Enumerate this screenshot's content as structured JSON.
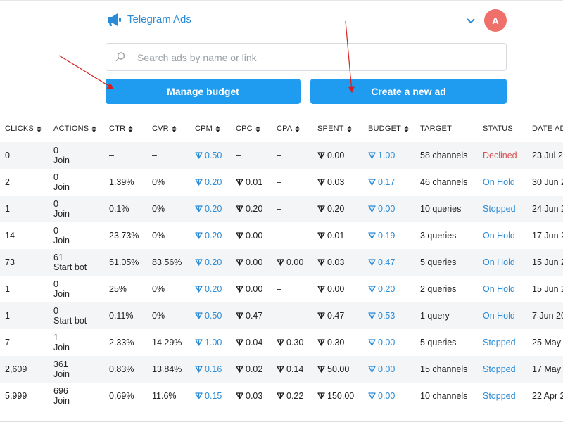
{
  "header": {
    "title": "Telegram Ads",
    "avatar_text": "A"
  },
  "search": {
    "placeholder": "Search ads by name or link"
  },
  "buttons": {
    "manage_budget": "Manage budget",
    "create_ad": "Create a new ad"
  },
  "table": {
    "headers": [
      "CLICKS",
      "ACTIONS",
      "CTR",
      "CVR",
      "CPM",
      "CPC",
      "CPA",
      "SPENT",
      "BUDGET",
      "TARGET",
      "STATUS",
      "DATE ADDED"
    ],
    "rows": [
      {
        "clicks": "0",
        "actions": "0",
        "action_label": "Join",
        "ctr": "–",
        "cvr": "–",
        "cpm": "0.50",
        "cpc": "–",
        "cpa": "–",
        "spent": "0.00",
        "budget": "1.00",
        "target": "58 channels",
        "status": "Declined",
        "date": "23 Jul 2"
      },
      {
        "clicks": "2",
        "actions": "0",
        "action_label": "Join",
        "ctr": "1.39%",
        "cvr": "0%",
        "cpm": "0.20",
        "cpc": "0.01",
        "cpa": "–",
        "spent": "0.03",
        "budget": "0.17",
        "target": "46 channels",
        "status": "On Hold",
        "date": "30 Jun 2"
      },
      {
        "clicks": "1",
        "actions": "0",
        "action_label": "Join",
        "ctr": "0.1%",
        "cvr": "0%",
        "cpm": "0.20",
        "cpc": "0.20",
        "cpa": "–",
        "spent": "0.20",
        "budget": "0.00",
        "target": "10 queries",
        "status": "Stopped",
        "date": "24 Jun 2"
      },
      {
        "clicks": "14",
        "actions": "0",
        "action_label": "Join",
        "ctr": "23.73%",
        "cvr": "0%",
        "cpm": "0.20",
        "cpc": "0.00",
        "cpa": "–",
        "spent": "0.01",
        "budget": "0.19",
        "target": "3 queries",
        "status": "On Hold",
        "date": "17 Jun 2"
      },
      {
        "clicks": "73",
        "actions": "61",
        "action_label": "Start bot",
        "ctr": "51.05%",
        "cvr": "83.56%",
        "cpm": "0.20",
        "cpc": "0.00",
        "cpa": "0.00",
        "spent": "0.03",
        "budget": "0.47",
        "target": "5 queries",
        "status": "On Hold",
        "date": "15 Jun 2"
      },
      {
        "clicks": "1",
        "actions": "0",
        "action_label": "Join",
        "ctr": "25%",
        "cvr": "0%",
        "cpm": "0.20",
        "cpc": "0.00",
        "cpa": "–",
        "spent": "0.00",
        "budget": "0.20",
        "target": "2 queries",
        "status": "On Hold",
        "date": "15 Jun 2"
      },
      {
        "clicks": "1",
        "actions": "0",
        "action_label": "Start bot",
        "ctr": "0.11%",
        "cvr": "0%",
        "cpm": "0.50",
        "cpc": "0.47",
        "cpa": "–",
        "spent": "0.47",
        "budget": "0.53",
        "target": "1 query",
        "status": "On Hold",
        "date": "7 Jun 20"
      },
      {
        "clicks": "7",
        "actions": "1",
        "action_label": "Join",
        "ctr": "2.33%",
        "cvr": "14.29%",
        "cpm": "1.00",
        "cpc": "0.04",
        "cpa": "0.30",
        "spent": "0.30",
        "budget": "0.00",
        "target": "5 queries",
        "status": "Stopped",
        "date": "25 May"
      },
      {
        "clicks": "2,609",
        "actions": "361",
        "action_label": "Join",
        "ctr": "0.83%",
        "cvr": "13.84%",
        "cpm": "0.16",
        "cpc": "0.02",
        "cpa": "0.14",
        "spent": "50.00",
        "budget": "0.00",
        "target": "15 channels",
        "status": "Stopped",
        "date": "17 May"
      },
      {
        "clicks": "5,999",
        "actions": "696",
        "action_label": "Join",
        "ctr": "0.69%",
        "cvr": "11.6%",
        "cpm": "0.15",
        "cpc": "0.03",
        "cpa": "0.22",
        "spent": "150.00",
        "budget": "0.00",
        "target": "10 channels",
        "status": "Stopped",
        "date": "22 Apr 2"
      }
    ]
  },
  "colors": {
    "accent": "#1f9bef",
    "link": "#2a8bd6",
    "declined": "#d9534f",
    "stripe": "#f3f5f7",
    "annotation_arrow": "#d62020"
  },
  "icons": {
    "logo": "megaphone-icon",
    "search": "search-icon",
    "dropdown": "chevron-down-icon",
    "currency": "ton-icon",
    "sort": "sort-icon"
  }
}
